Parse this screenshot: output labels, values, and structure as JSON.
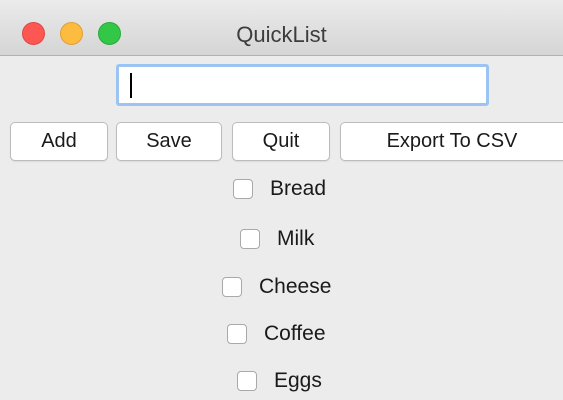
{
  "window": {
    "title": "QuickList",
    "controls": [
      "close",
      "minimize",
      "zoom"
    ],
    "colors": {
      "close": "#fc5753",
      "minimize": "#fdbc40",
      "zoom": "#33c748"
    }
  },
  "input": {
    "value": ""
  },
  "buttons": {
    "add": "Add",
    "save": "Save",
    "quit": "Quit",
    "export": "Export To CSV"
  },
  "items": [
    {
      "label": "Bread",
      "checked": false
    },
    {
      "label": "Milk",
      "checked": false
    },
    {
      "label": "Cheese",
      "checked": false
    },
    {
      "label": "Coffee",
      "checked": false
    },
    {
      "label": "Eggs",
      "checked": false
    }
  ]
}
